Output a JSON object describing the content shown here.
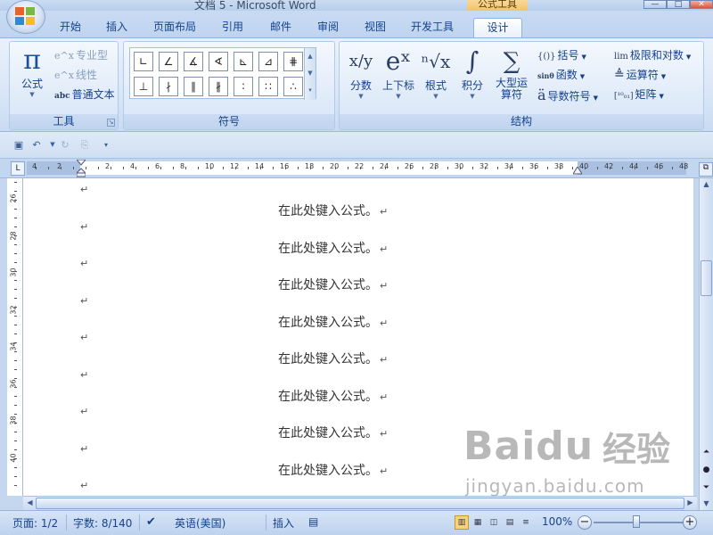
{
  "window": {
    "title": "文档 5 - Microsoft Word",
    "context_tool": "公式工具",
    "minimize": "—",
    "maximize": "□",
    "close": "✕"
  },
  "tabs": {
    "items": [
      "开始",
      "插入",
      "页面布局",
      "引用",
      "邮件",
      "审阅",
      "视图",
      "开发工具"
    ],
    "active": "设计"
  },
  "ribbon": {
    "tools": {
      "label": "工具",
      "equation": {
        "glyph": "π",
        "label": "公式"
      },
      "professional": {
        "icon": "e^x",
        "label": "专业型"
      },
      "linear": {
        "icon": "e^x",
        "label": "线性"
      },
      "normal_text": {
        "icon": "abc",
        "label": "普通文本"
      }
    },
    "symbols": {
      "label": "符号",
      "row1": [
        "∟",
        "∠",
        "∡",
        "∢",
        "⊾",
        "⊿",
        "⋕"
      ],
      "row2": [
        "⊥",
        "∤",
        "∥",
        "∦",
        "∶",
        "∷",
        "∴"
      ]
    },
    "structures": {
      "label": "结构",
      "fraction": {
        "glyph": "x/y",
        "label": "分数"
      },
      "script": {
        "glyph": "eˣ",
        "label": "上下标"
      },
      "radical": {
        "glyph": "ⁿ√x",
        "label": "根式"
      },
      "integral": {
        "glyph": "∫",
        "label": "积分"
      },
      "large_operator": {
        "glyph": "∑",
        "label": "大型运算符"
      },
      "bracket": {
        "icon": "{()}",
        "label": "括号"
      },
      "function": {
        "icon": "sinθ",
        "label": "函数"
      },
      "accent": {
        "icon": "ä",
        "label": "导数符号"
      },
      "limit_log": {
        "icon": "lim",
        "label": "极限和对数"
      },
      "operator": {
        "icon": "≜",
        "label": "运算符"
      },
      "matrix": {
        "icon": "[¹⁰₀₁]",
        "label": "矩阵"
      }
    }
  },
  "ruler": {
    "tab_selector": "L",
    "numbers": [
      "4",
      "2",
      "2",
      "4",
      "6",
      "8",
      "10",
      "12",
      "14",
      "16",
      "18",
      "20",
      "22",
      "24",
      "26",
      "28",
      "30",
      "32",
      "34",
      "36",
      "38",
      "40",
      "42",
      "44",
      "46",
      "48"
    ]
  },
  "vertical_ruler": {
    "numbers": [
      "26",
      "28",
      "30",
      "32",
      "34",
      "36",
      "38",
      "40"
    ]
  },
  "document": {
    "paragraph_mark": "↵",
    "equation_placeholder": "在此处键入公式。",
    "equation_count": 8
  },
  "statusbar": {
    "page": "页面: 1/2",
    "words": "字数: 8/140",
    "language": "英语(美国)",
    "insert_mode": "插入",
    "zoom": "100%"
  },
  "watermark": {
    "brand": "Baidu",
    "sub": "经验",
    "url": "jingyan.baidu.com"
  }
}
